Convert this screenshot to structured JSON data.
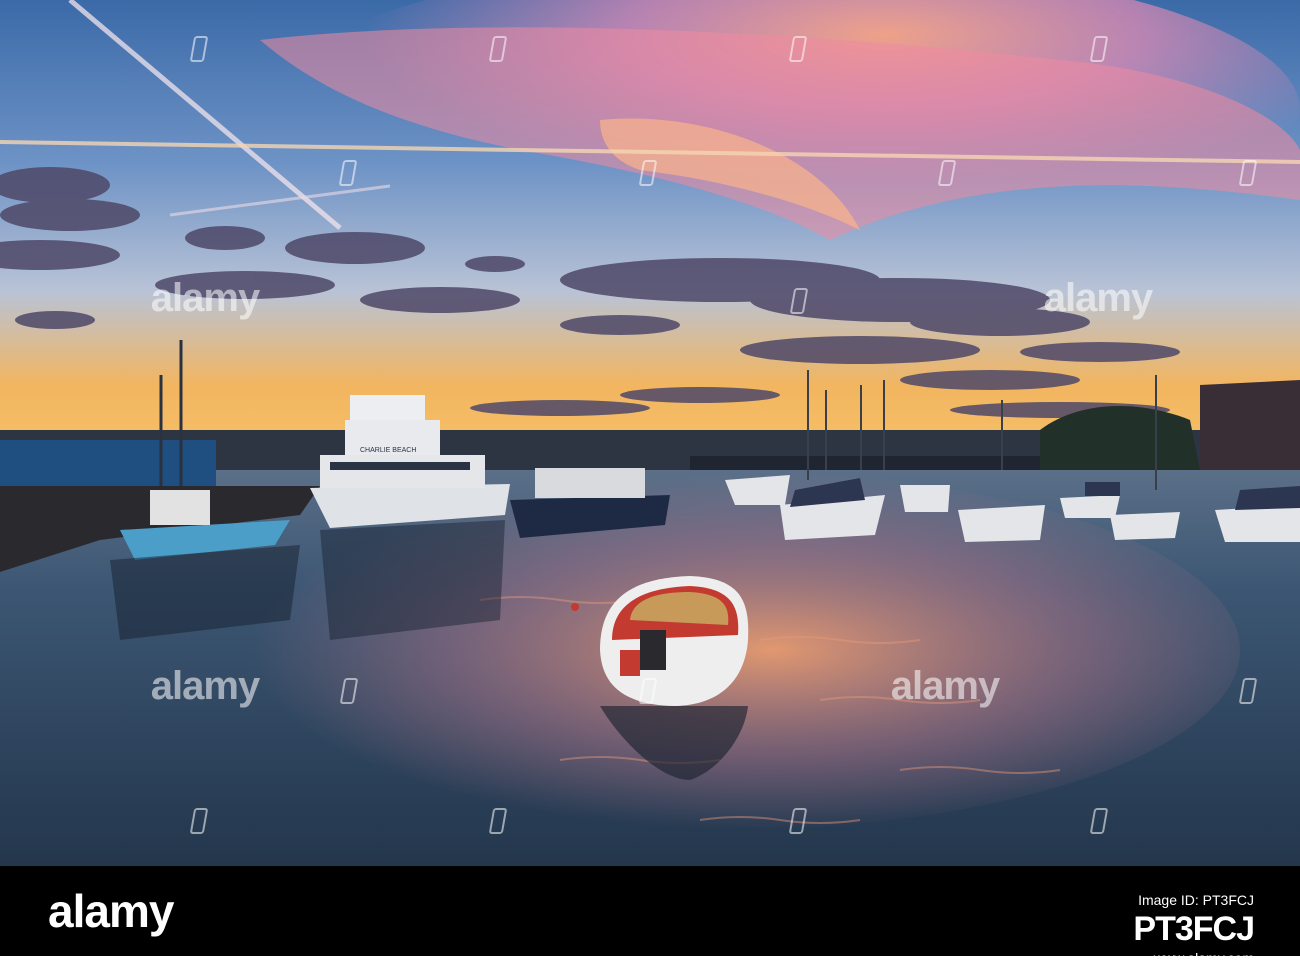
{
  "watermark": {
    "brand": "alamy",
    "mark_color": "#ffffff"
  },
  "footer": {
    "logo": "alamy",
    "background": "#000000",
    "image_id_label": "Image ID: PT3FCJ",
    "image_id": "PT3FCJ",
    "site": "www.alamy.com"
  },
  "scene": {
    "subject": "harbour-at-sunset",
    "boat_name": "CHARLIE BEACH",
    "palette": {
      "sky_top": "#3e6fb0",
      "sky_mid": "#8cb0d8",
      "horizon": "#f6b24e",
      "cloud_pink": "#f08aa8",
      "cloud_dark": "#4a4464",
      "water": "#2e4860"
    }
  }
}
